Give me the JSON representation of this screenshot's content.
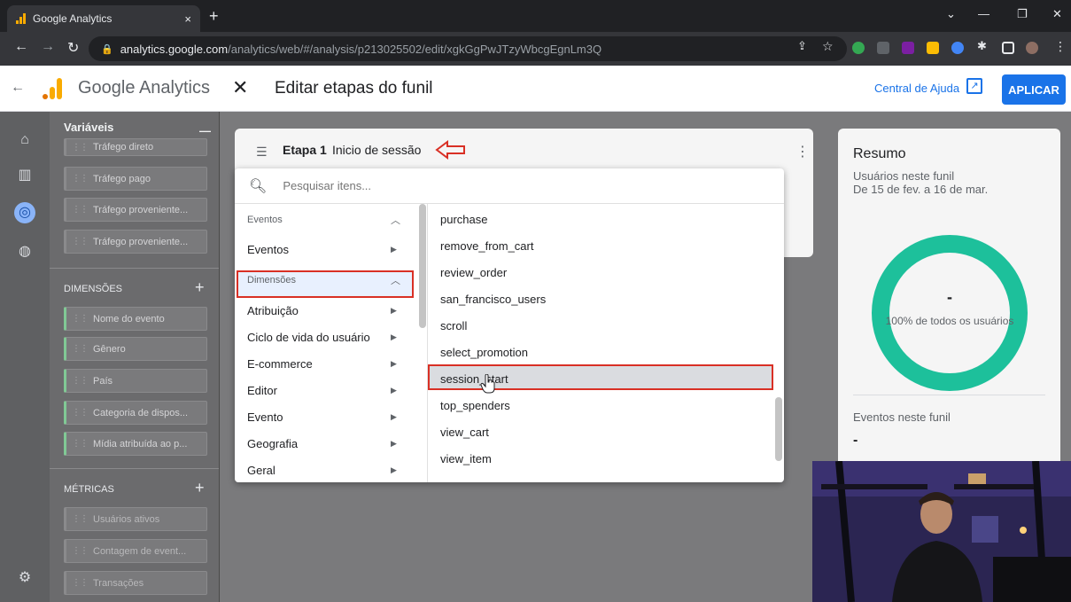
{
  "browser": {
    "tab_title": "Google Analytics",
    "tab_close": "×",
    "new_tab": "+",
    "url_host": "analytics.google.com",
    "url_path": "/analytics/web/#/analysis/p213025502/edit/xgkGgPwJTzyWbcgEgnLm3Q"
  },
  "header": {
    "app_name": "Google Analytics",
    "dialog_title": "Editar etapas do funil",
    "help_label": "Central de Ajuda",
    "apply_label": "APLICAR"
  },
  "variables": {
    "title": "Variáveis",
    "segments": [
      "Tráfego direto",
      "Tráfego pago",
      "Tráfego proveniente...",
      "Tráfego proveniente..."
    ],
    "dimensions_label": "DIMENSÕES",
    "dimensions": [
      "Nome do evento",
      "Gênero",
      "País",
      "Categoria de dispos...",
      "Mídia atribuída ao p..."
    ],
    "metrics_label": "MÉTRICAS",
    "metrics": [
      "Usuários ativos",
      "Contagem de event...",
      "Transações"
    ]
  },
  "step": {
    "label": "Etapa 1",
    "name": "Inicio de sessão"
  },
  "picker": {
    "search_placeholder": "Pesquisar itens...",
    "group_events": "Eventos",
    "selected_category": "Eventos",
    "group_dimensions": "Dimensões",
    "categories": [
      "Atribuição",
      "Ciclo de vida do usuário",
      "E-commerce",
      "Editor",
      "Evento",
      "Geografia",
      "Geral"
    ],
    "events": [
      "purchase",
      "remove_from_cart",
      "review_order",
      "san_francisco_users",
      "scroll",
      "select_promotion",
      "session_start",
      "top_spenders",
      "view_cart",
      "view_item"
    ],
    "selected_event": "session_start"
  },
  "summary": {
    "title": "Resumo",
    "users_label": "Usuários neste funil",
    "date_range": "De 15 de fev. a 16 de mar.",
    "donut_value": "-",
    "donut_caption": "100% de todos os usuários",
    "events_label": "Eventos neste funil",
    "events_value": "-"
  },
  "colors": {
    "accent": "#1a73e8",
    "highlight_border": "#d93025",
    "donut": "#1dc09b"
  }
}
